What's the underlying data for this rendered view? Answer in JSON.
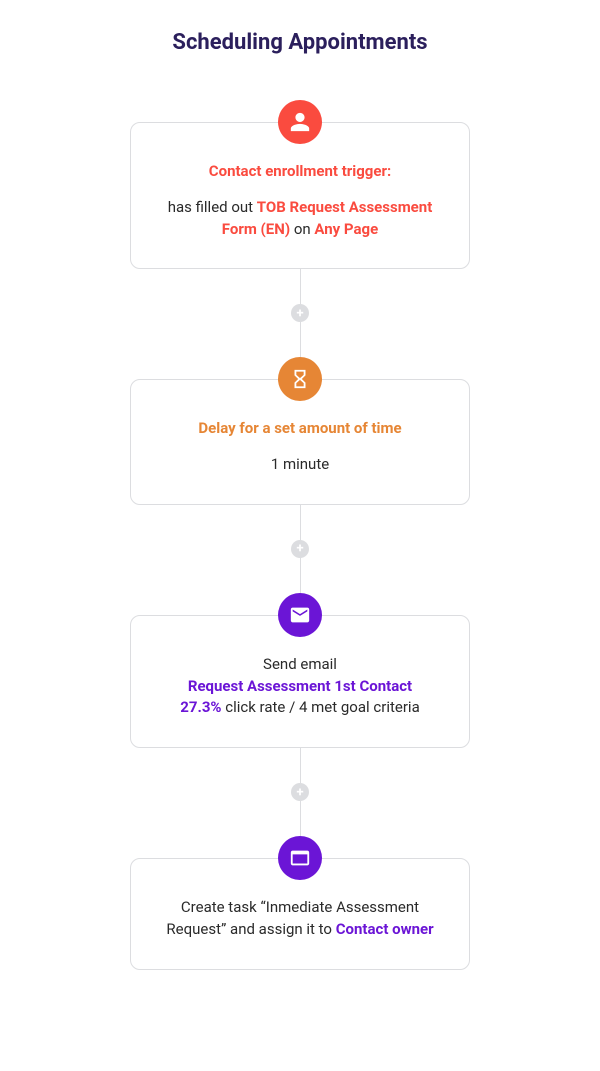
{
  "title": "Scheduling Appointments",
  "steps": {
    "trigger": {
      "heading": "Contact enrollment trigger:",
      "pre": "has filled out ",
      "form": "TOB Request Assessment Form (EN)",
      "mid": " on ",
      "page": "Any Page"
    },
    "delay": {
      "heading": "Delay for a set amount of time",
      "duration": "1 minute"
    },
    "email": {
      "pre": "Send email",
      "name": "Request Assessment 1st Contact",
      "rate": "27.3%",
      "rate_suffix": " click rate / 4 met goal criteria"
    },
    "task": {
      "pre": "Create task “Inmediate Assessment Request” and assign it to ",
      "owner": "Contact owner"
    }
  },
  "plus": "+"
}
